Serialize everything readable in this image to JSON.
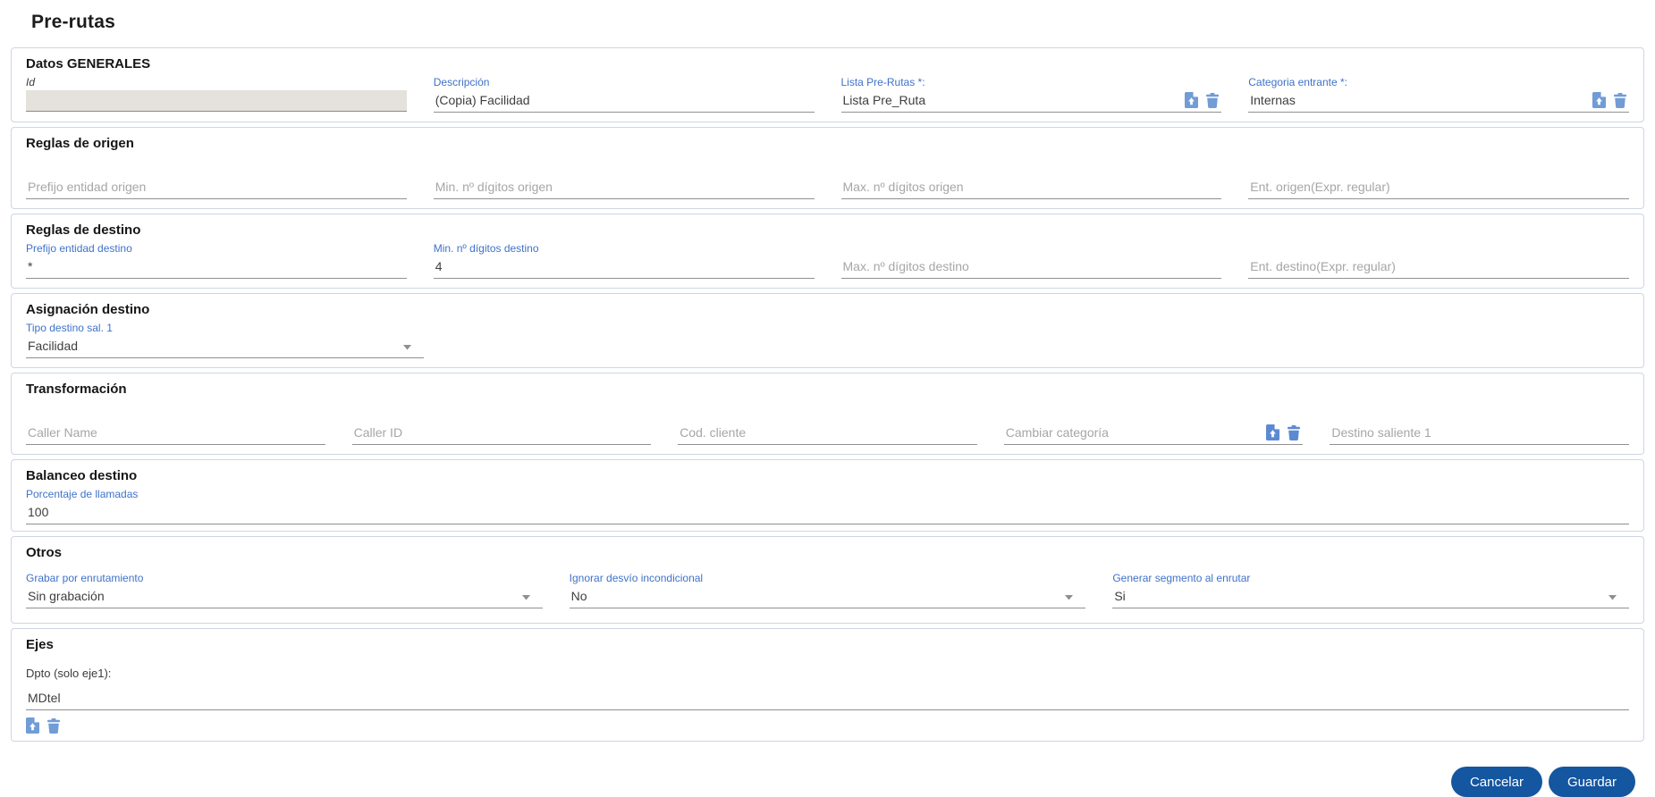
{
  "page": {
    "title": "Pre-rutas"
  },
  "actions": {
    "cancel_label": "Cancelar",
    "save_label": "Guardar"
  },
  "colors": {
    "label_blue": "#3f72c9",
    "icon_blue": "#719cd6",
    "button_blue": "#1456a0",
    "disabled_field_bg": "#e5e2dd",
    "card_border": "#ccd6e3"
  },
  "icons": {
    "export_document": "document-with-up-arrow",
    "trash": "trash-can",
    "caret": "triangle-down"
  },
  "sections": {
    "datos_generales": {
      "title": "Datos GENERALES",
      "id": {
        "label": "Id",
        "value": ""
      },
      "descripcion": {
        "label": "Descripción",
        "value": "(Copia) Facilidad"
      },
      "lista_pre_rutas": {
        "label": "Lista Pre-Rutas *:",
        "value": "Lista Pre_Ruta"
      },
      "categoria_entrante": {
        "label": "Categoria entrante *:",
        "value": "Internas"
      }
    },
    "reglas_origen": {
      "title": "Reglas de origen",
      "prefijo": {
        "placeholder": "Prefijo entidad origen"
      },
      "min_digitos": {
        "placeholder": "Min. nº dígitos origen"
      },
      "max_digitos": {
        "placeholder": "Max. nº dígitos origen"
      },
      "ent_regular": {
        "placeholder": "Ent. origen(Expr. regular)"
      }
    },
    "reglas_destino": {
      "title": "Reglas de destino",
      "prefijo": {
        "label": "Prefijo entidad destino",
        "value": "*"
      },
      "min_digitos": {
        "label": "Min. nº dígitos destino",
        "value": "4"
      },
      "max_digitos": {
        "placeholder": "Max. nº dígitos destino"
      },
      "ent_regular": {
        "placeholder": "Ent. destino(Expr. regular)"
      }
    },
    "asignacion_destino": {
      "title": "Asignación destino",
      "tipo_destino": {
        "label": "Tipo destino sal. 1",
        "value": "Facilidad"
      }
    },
    "transformacion": {
      "title": "Transformación",
      "caller_name": {
        "placeholder": "Caller Name"
      },
      "caller_id": {
        "placeholder": "Caller ID"
      },
      "cod_cliente": {
        "placeholder": "Cod. cliente"
      },
      "cambiar_categoria": {
        "placeholder": "Cambiar categoría"
      },
      "destino_saliente": {
        "placeholder": "Destino saliente 1"
      }
    },
    "balanceo_destino": {
      "title": "Balanceo destino",
      "porcentaje": {
        "label": "Porcentaje de llamadas",
        "value": "100"
      }
    },
    "otros": {
      "title": "Otros",
      "grabar": {
        "label": "Grabar por enrutamiento",
        "value": "Sin grabación"
      },
      "ignorar_desvio": {
        "label": "Ignorar desvío incondicional",
        "value": "No"
      },
      "generar_segmento": {
        "label": "Generar segmento al enrutar",
        "value": "Si"
      }
    },
    "ejes": {
      "title": "Ejes",
      "dpto": {
        "label": "Dpto (solo eje1):",
        "value": "MDtel"
      }
    }
  }
}
